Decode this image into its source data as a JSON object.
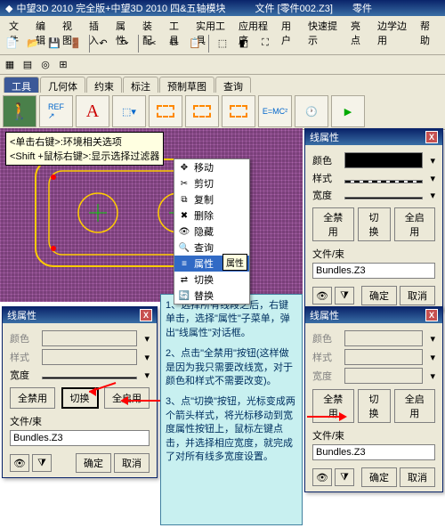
{
  "titlebar": {
    "app": "中望3D 2010 完全版+中望3D 2010 四&五轴模块",
    "file": "文件 [零件002.Z3]",
    "type": "零件"
  },
  "menu": [
    "文件",
    "编辑",
    "视图",
    "插入",
    "属性",
    "装配",
    "工具",
    "实用工具",
    "应用程序",
    "用户",
    "快速提示",
    "亮点",
    "边学边用",
    "帮助"
  ],
  "toolbar1_icons": [
    "new",
    "open",
    "save",
    "exit",
    "undo",
    "redo",
    "ref",
    "wire",
    "shade",
    "iso",
    "fit"
  ],
  "tabs": [
    "工具",
    "几何体",
    "约束",
    "标注",
    "预制草图",
    "查询"
  ],
  "bigtool_icons": [
    "exit",
    "ref",
    "text",
    "shape",
    "rect1",
    "rect2",
    "rect3",
    "emc2",
    "clock",
    "flag"
  ],
  "hint": {
    "l1": "<单击右键>:环境相关选项",
    "l2": "<Shift +鼠标右键>:显示选择过滤器"
  },
  "ctx": {
    "items": [
      "移动",
      "剪切",
      "复制",
      "删除",
      "隐藏",
      "查询",
      "属性",
      "切换",
      "替换"
    ],
    "tooltip": "属性"
  },
  "panel": {
    "title": "线属性",
    "labels": {
      "color": "颜色",
      "style": "样式",
      "width": "宽度"
    },
    "buttons": {
      "disable_all": "全禁用",
      "toggle": "切换",
      "enable_all": "全启用"
    },
    "file_label": "文件/束",
    "file_value": "Bundles.Z3",
    "ok": "确定",
    "cancel": "取消"
  },
  "notes": {
    "n1": "1、选择所有线段之后，右键单击，选择\"属性\"子菜单，弹出\"线属性\"对话框。",
    "n2": "2、点击\"全禁用\"按钮(这样做是因为我只需要改线宽，对于颜色和样式不需要改变)。",
    "n3": "3、点\"切换\"按钮，光标变成两个箭头样式，将光标移动到宽度属性按钮上，鼠标左键点击，并选择相应宽度，就完成了对所有线多宽度设置。"
  }
}
